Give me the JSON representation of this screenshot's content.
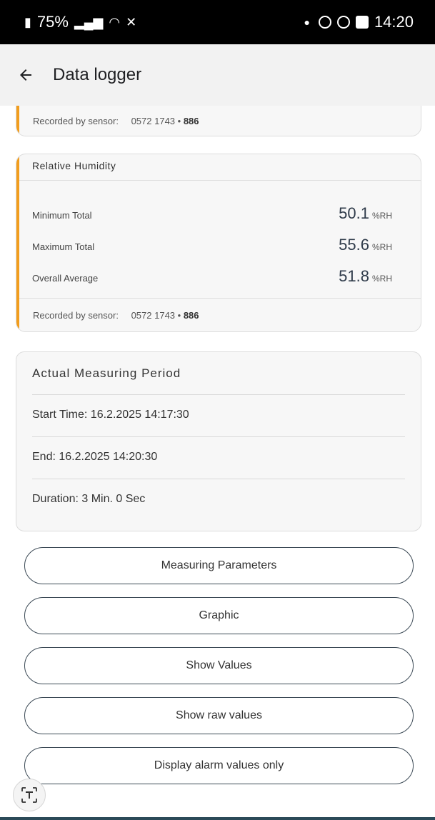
{
  "status_bar": {
    "battery": "75%",
    "time": "14:20"
  },
  "app_bar": {
    "title": "Data logger"
  },
  "top_card": {
    "recorded_label": "Recorded by sensor:",
    "sensor_id": "0572 1743 •",
    "sensor_num": "886"
  },
  "humidity_card": {
    "title": "Relative Humidity",
    "rows": [
      {
        "label": "Minimum Total",
        "value": "50.1",
        "unit": "%RH"
      },
      {
        "label": "Maximum Total",
        "value": "55.6",
        "unit": "%RH"
      },
      {
        "label": "Overall Average",
        "value": "51.8",
        "unit": "%RH"
      }
    ],
    "recorded_label": "Recorded by sensor:",
    "sensor_id": "0572 1743 •",
    "sensor_num": "886"
  },
  "period": {
    "title": "Actual Measuring Period",
    "start": "Start Time: 16.2.2025 14:17:30",
    "end": "End: 16.2.2025 14:20:30",
    "duration": "Duration: 3 Min. 0 Sec"
  },
  "buttons": {
    "measuring_parameters": "Measuring Parameters",
    "graphic": "Graphic",
    "show_values": "Show Values",
    "show_raw_values": "Show raw values",
    "alarm_only": "Display alarm values only"
  },
  "colors": {
    "accent": "#f29d1d",
    "pill_border": "#3c4a56"
  }
}
